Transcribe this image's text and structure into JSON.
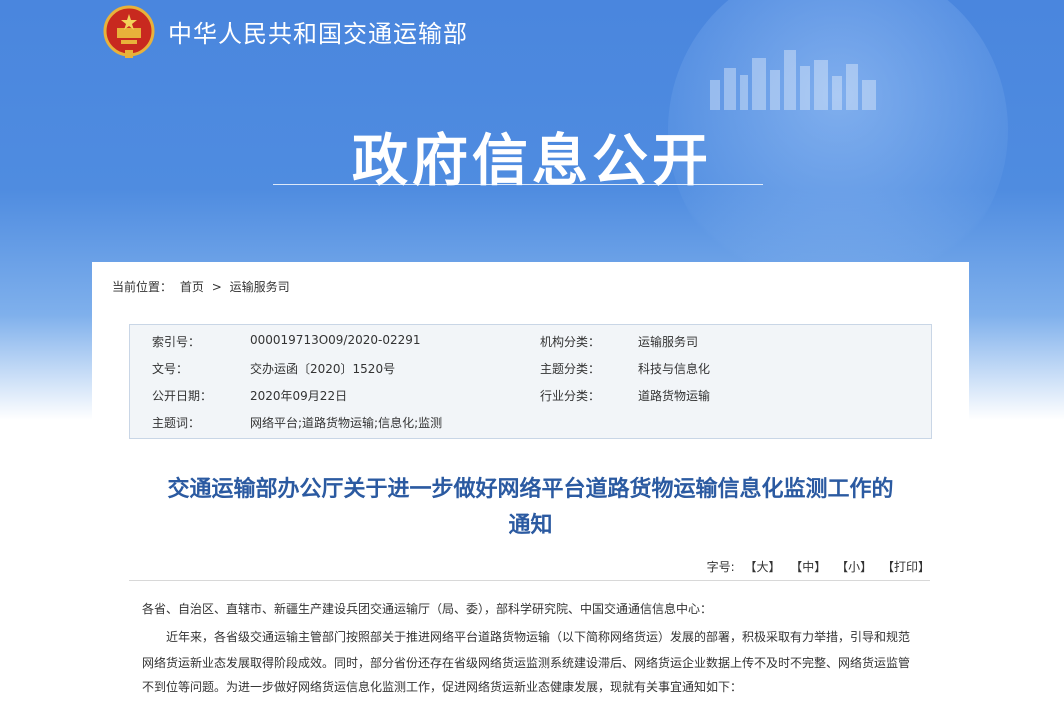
{
  "header": {
    "ministry_name": "中华人民共和国交通运输部",
    "page_title": "政府信息公开"
  },
  "breadcrumb": {
    "label": "当前位置：",
    "home": "首页",
    "separator": ">",
    "current": "运输服务司"
  },
  "info": {
    "rows": [
      {
        "k1": "索引号：",
        "v1": "000019713O09/2020-02291",
        "k2": "机构分类：",
        "v2": "运输服务司"
      },
      {
        "k1": "文号：",
        "v1": "交办运函〔2020〕1520号",
        "k2": "主题分类：",
        "v2": "科技与信息化"
      },
      {
        "k1": "公开日期：",
        "v1": "2020年09月22日",
        "k2": "行业分类：",
        "v2": "道路货物运输"
      },
      {
        "k1": "主题词：",
        "v1": "网络平台;道路货物运输;信息化;监测",
        "k2": "",
        "v2": ""
      }
    ]
  },
  "article": {
    "title_line1": "交通运输部办公厅关于进一步做好网络平台道路货物运输信息化监测工作的",
    "title_line2": "通知",
    "font_size_label": "字号:",
    "font_large": "【大】",
    "font_medium": "【中】",
    "font_small": "【小】",
    "print": "【打印】",
    "para1": "各省、自治区、直辖市、新疆生产建设兵团交通运输厅（局、委），部科学研究院、中国交通通信信息中心：",
    "para2_line1": "近年来，各省级交通运输主管部门按照部关于推进网络平台道路货物运输（以下简称网络货运）发展的部署，积极采取有力举措，引导和规范",
    "para2_line2": "网络货运新业态发展取得阶段成效。同时，部分省份还存在省级网络货运监测系统建设滞后、网络货运企业数据上传不及时不完整、网络货运监管",
    "para2_line3": "不到位等问题。为进一步做好网络货运信息化监测工作，促进网络货运新业态健康发展，现就有关事宜通知如下："
  }
}
